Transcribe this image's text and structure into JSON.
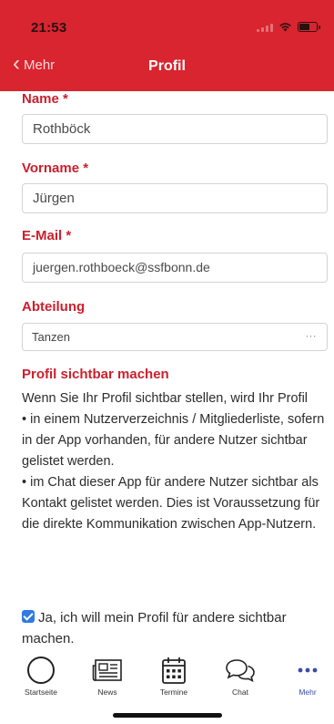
{
  "status_bar": {
    "time": "21:53"
  },
  "nav": {
    "back_label": "Mehr",
    "title": "Profil"
  },
  "form": {
    "name": {
      "label": "Name *",
      "value": "Rothböck"
    },
    "vorname": {
      "label": "Vorname *",
      "value": "Jürgen"
    },
    "email": {
      "label": "E-Mail *",
      "value": "juergen.rothboeck@ssfbonn.de"
    },
    "abteilung": {
      "label": "Abteilung",
      "value": "Tanzen",
      "more": "···"
    }
  },
  "visibility": {
    "heading": "Profil sichtbar machen",
    "intro": "Wenn Sie Ihr Profil sichtbar stellen, wird Ihr Profil",
    "bullet1": "•  in einem Nutzerverzeichnis / Mitgliederliste, sofern in der App vorhanden, für andere Nutzer sichtbar gelistet werden.",
    "bullet2": "•  im Chat dieser App für andere Nutzer sichtbar als Kontakt gelistet werden. Dies ist Voraussetzung für die direkte Kommunikation zwischen App-Nutzern.",
    "consent_label": "Ja, ich will mein Profil für andere sichtbar machen.",
    "consent_checked": true
  },
  "tabbar": {
    "items": [
      {
        "label": "Startseite",
        "icon": "circle-icon"
      },
      {
        "label": "News",
        "icon": "newspaper-icon"
      },
      {
        "label": "Termine",
        "icon": "calendar-icon"
      },
      {
        "label": "Chat",
        "icon": "chat-bubbles-icon"
      },
      {
        "label": "Mehr",
        "icon": "more-dots-icon",
        "active": true
      }
    ]
  },
  "colors": {
    "brand_red": "#d8252f",
    "label_red": "#cc1f2c",
    "active_tab": "#3b4aa8",
    "checkbox_blue": "#2f7be0"
  }
}
